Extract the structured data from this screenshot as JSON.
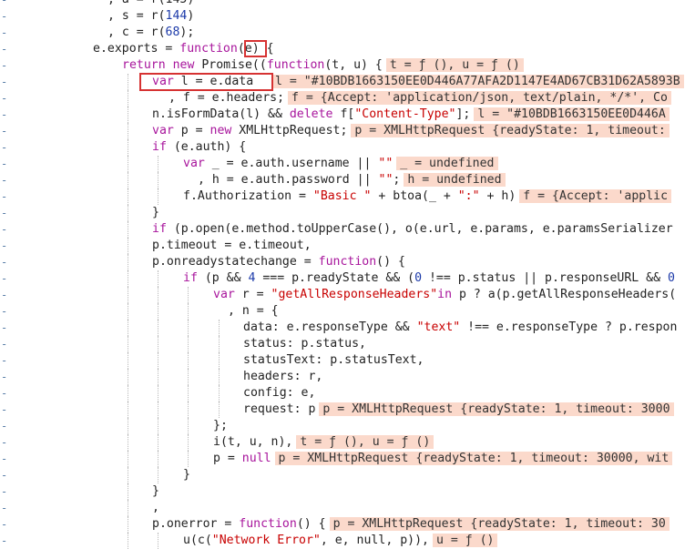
{
  "gutter_marker": "-",
  "lines": [
    {
      "indent": 118,
      "guides": [],
      "segs": [
        [
          "p",
          ", a = r(145)"
        ]
      ]
    },
    {
      "indent": 118,
      "guides": [],
      "segs": [
        [
          "p",
          ", s = r("
        ],
        [
          "n",
          "144"
        ],
        [
          "p",
          ")"
        ]
      ]
    },
    {
      "indent": 118,
      "guides": [],
      "segs": [
        [
          "p",
          ", c = r("
        ],
        [
          "n",
          "68"
        ],
        [
          "p",
          ");"
        ]
      ]
    },
    {
      "indent": 102,
      "guides": [],
      "segs": [
        [
          "p",
          "e.exports = "
        ],
        [
          "k",
          "function"
        ],
        [
          "p",
          "(e) {"
        ]
      ]
    },
    {
      "indent": 134,
      "guides": [],
      "segs": [
        [
          "k",
          "return new"
        ],
        [
          "p",
          " Promise(("
        ],
        [
          "k",
          "function"
        ],
        [
          "p",
          "(t, u) {"
        ],
        [
          "h",
          "t = ƒ (), u = ƒ ()"
        ]
      ]
    },
    {
      "indent": 167,
      "guides": [
        140
      ],
      "segs": [
        [
          "k",
          "var"
        ],
        [
          "p",
          " l = e.data  "
        ],
        [
          "h",
          "l = \"#10BDB1663150EE0D446A77AFA2D1147E4AD67CB31D62A5893B"
        ]
      ]
    },
    {
      "indent": 185,
      "guides": [
        140
      ],
      "segs": [
        [
          "p",
          ", f = e.headers;"
        ],
        [
          "h",
          "f = {Accept: 'application/json, text/plain, */*', Co"
        ]
      ]
    },
    {
      "indent": 167,
      "guides": [
        140
      ],
      "segs": [
        [
          "p",
          "n.isFormData(l) && "
        ],
        [
          "k",
          "delete"
        ],
        [
          "p",
          " f["
        ],
        [
          "s",
          "\"Content-Type\""
        ],
        [
          "p",
          "];"
        ],
        [
          "h",
          "l = \"#10BDB1663150EE0D446A"
        ]
      ]
    },
    {
      "indent": 167,
      "guides": [
        140
      ],
      "segs": [
        [
          "k",
          "var"
        ],
        [
          "p",
          " p = "
        ],
        [
          "k",
          "new"
        ],
        [
          "p",
          " XMLHttpRequest;"
        ],
        [
          "h",
          "p = XMLHttpRequest {readyState: 1, timeout:"
        ]
      ]
    },
    {
      "indent": 167,
      "guides": [
        140
      ],
      "segs": [
        [
          "k",
          "if"
        ],
        [
          "p",
          " (e.auth) {"
        ]
      ]
    },
    {
      "indent": 201,
      "guides": [
        140,
        173
      ],
      "segs": [
        [
          "k",
          "var"
        ],
        [
          "p",
          " _ = e.auth.username || "
        ],
        [
          "s",
          "\"\""
        ],
        [
          "h",
          "_ = undefined"
        ]
      ]
    },
    {
      "indent": 217,
      "guides": [
        140,
        173
      ],
      "segs": [
        [
          "p",
          ", h = e.auth.password || "
        ],
        [
          "s",
          "\"\""
        ],
        [
          "p",
          ";"
        ],
        [
          "h",
          "h = undefined"
        ]
      ]
    },
    {
      "indent": 201,
      "guides": [
        140,
        173
      ],
      "segs": [
        [
          "p",
          "f.Authorization = "
        ],
        [
          "s",
          "\"Basic \""
        ],
        [
          "p",
          " + btoa(_ + "
        ],
        [
          "s",
          "\":\""
        ],
        [
          "p",
          " + h)"
        ],
        [
          "h",
          "f = {Accept: 'applic"
        ]
      ]
    },
    {
      "indent": 167,
      "guides": [
        140
      ],
      "segs": [
        [
          "p",
          "}"
        ]
      ]
    },
    {
      "indent": 167,
      "guides": [
        140
      ],
      "segs": [
        [
          "k",
          "if"
        ],
        [
          "p",
          " (p.open(e.method.toUpperCase(), o(e.url, e.params, e.paramsSerializer"
        ]
      ]
    },
    {
      "indent": 167,
      "guides": [
        140
      ],
      "segs": [
        [
          "p",
          "p.timeout = e.timeout,"
        ]
      ]
    },
    {
      "indent": 167,
      "guides": [
        140
      ],
      "segs": [
        [
          "p",
          "p.onreadystatechange = "
        ],
        [
          "k",
          "function"
        ],
        [
          "p",
          "() {"
        ]
      ]
    },
    {
      "indent": 201,
      "guides": [
        140,
        173
      ],
      "segs": [
        [
          "k",
          "if"
        ],
        [
          "p",
          " (p && "
        ],
        [
          "n",
          "4"
        ],
        [
          "p",
          " === p.readyState && ("
        ],
        [
          "n",
          "0"
        ],
        [
          "p",
          " !== p.status || p.responseURL && "
        ],
        [
          "n",
          "0"
        ]
      ]
    },
    {
      "indent": 234,
      "guides": [
        140,
        173,
        206
      ],
      "segs": [
        [
          "k",
          "var"
        ],
        [
          "p",
          " r = "
        ],
        [
          "s",
          "\"getAllResponseHeaders\""
        ],
        [
          "k",
          "in"
        ],
        [
          "p",
          " p ? a(p.getAllResponseHeaders("
        ]
      ]
    },
    {
      "indent": 250,
      "guides": [
        140,
        173,
        206
      ],
      "segs": [
        [
          "p",
          ", n = {"
        ]
      ]
    },
    {
      "indent": 267,
      "guides": [
        140,
        173,
        206,
        240
      ],
      "segs": [
        [
          "p",
          "data: e.responseType && "
        ],
        [
          "s",
          "\"text\""
        ],
        [
          "p",
          " !== e.responseType ? p.respon"
        ]
      ]
    },
    {
      "indent": 267,
      "guides": [
        140,
        173,
        206,
        240
      ],
      "segs": [
        [
          "p",
          "status: p.status,"
        ]
      ]
    },
    {
      "indent": 267,
      "guides": [
        140,
        173,
        206,
        240
      ],
      "segs": [
        [
          "p",
          "statusText: p.statusText,"
        ]
      ]
    },
    {
      "indent": 267,
      "guides": [
        140,
        173,
        206,
        240
      ],
      "segs": [
        [
          "p",
          "headers: r,"
        ]
      ]
    },
    {
      "indent": 267,
      "guides": [
        140,
        173,
        206,
        240
      ],
      "segs": [
        [
          "p",
          "config: e,"
        ]
      ]
    },
    {
      "indent": 267,
      "guides": [
        140,
        173,
        206,
        240
      ],
      "segs": [
        [
          "p",
          "request: p"
        ],
        [
          "h",
          "p = XMLHttpRequest {readyState: 1, timeout: 3000"
        ]
      ]
    },
    {
      "indent": 234,
      "guides": [
        140,
        173,
        206
      ],
      "segs": [
        [
          "p",
          "};"
        ]
      ]
    },
    {
      "indent": 234,
      "guides": [
        140,
        173,
        206
      ],
      "segs": [
        [
          "p",
          "i(t, u, n),"
        ],
        [
          "h",
          "t = ƒ (), u = ƒ ()"
        ]
      ]
    },
    {
      "indent": 234,
      "guides": [
        140,
        173,
        206
      ],
      "segs": [
        [
          "p",
          "p = "
        ],
        [
          "k",
          "null"
        ],
        [
          "h",
          "p = XMLHttpRequest {readyState: 1, timeout: 30000, wit"
        ]
      ]
    },
    {
      "indent": 201,
      "guides": [
        140,
        173
      ],
      "segs": [
        [
          "p",
          "}"
        ]
      ]
    },
    {
      "indent": 167,
      "guides": [
        140
      ],
      "segs": [
        [
          "p",
          "}"
        ]
      ]
    },
    {
      "indent": 167,
      "guides": [
        140
      ],
      "segs": [
        [
          "p",
          ","
        ]
      ]
    },
    {
      "indent": 167,
      "guides": [
        140
      ],
      "segs": [
        [
          "p",
          "p.onerror = "
        ],
        [
          "k",
          "function"
        ],
        [
          "p",
          "() {"
        ],
        [
          "h",
          "p = XMLHttpRequest {readyState: 1, timeout: 30"
        ]
      ]
    },
    {
      "indent": 201,
      "guides": [
        140,
        173
      ],
      "segs": [
        [
          "p",
          "u(c("
        ],
        [
          "s",
          "\"Network Error\""
        ],
        [
          "p",
          ", e, null, p)),"
        ],
        [
          "h",
          "u = ƒ ()"
        ]
      ]
    }
  ]
}
